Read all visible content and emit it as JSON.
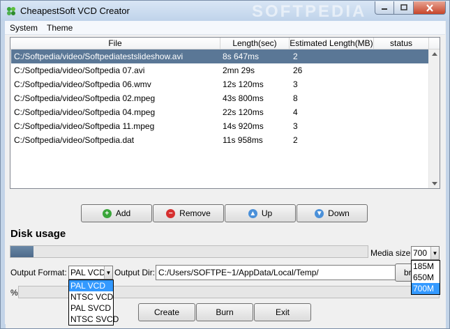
{
  "window": {
    "title": "CheapestSoft VCD Creator",
    "watermark": "SOFTPEDIA",
    "min_icon": "minimize-icon",
    "max_icon": "maximize-icon",
    "close_icon": "close-icon"
  },
  "menu": {
    "items": [
      "System",
      "Theme"
    ]
  },
  "file_list": {
    "columns": [
      "File",
      "Length(sec)",
      "Estimated Length(MB)",
      "status"
    ],
    "rows": [
      {
        "file": "C:/Softpedia/video/Softpediatestslideshow.avi",
        "length": "8s 647ms",
        "size": "2",
        "status": ""
      },
      {
        "file": "C:/Softpedia/video/Softpedia 07.avi",
        "length": "2mn 29s",
        "size": "26",
        "status": ""
      },
      {
        "file": "C:/Softpedia/video/Softpedia 06.wmv",
        "length": "12s 120ms",
        "size": "3",
        "status": ""
      },
      {
        "file": "C:/Softpedia/video/Softpedia 02.mpeg",
        "length": "43s 800ms",
        "size": "8",
        "status": ""
      },
      {
        "file": "C:/Softpedia/video/Softpedia 04.mpeg",
        "length": "22s 120ms",
        "size": "4",
        "status": ""
      },
      {
        "file": "C:/Softpedia/video/Softpedia 11.mpeg",
        "length": "14s 920ms",
        "size": "3",
        "status": ""
      },
      {
        "file": "C:/Softpedia/video/Softpedia.dat",
        "length": "11s 958ms",
        "size": "2",
        "status": ""
      }
    ],
    "selected_row": 0
  },
  "list_buttons": {
    "add": "Add",
    "remove": "Remove",
    "up": "Up",
    "down": "Down"
  },
  "disk": {
    "title": "Disk usage",
    "usage_fraction": 0.065,
    "media_size_label": "Media size:",
    "media_size_value": "700",
    "media_size_options": [
      "185M",
      "650M",
      "700M"
    ],
    "media_size_selected": "700M"
  },
  "output": {
    "format_label": "Output Format:",
    "format_value": "PAL VCD",
    "format_options": [
      "PAL VCD",
      "NTSC VCD",
      "PAL SVCD",
      "NTSC SVCD"
    ],
    "format_selected": "PAL VCD",
    "dir_label": "Output Dir:",
    "dir_value": "C:/Users/SOFTPE~1/AppData/Local/Temp/",
    "browse_label": "br"
  },
  "progress": {
    "label": "%",
    "fraction": 0
  },
  "actions": {
    "create": "Create",
    "burn": "Burn",
    "exit": "Exit"
  },
  "colors": {
    "selection": "#5a7796",
    "dropdown_highlight": "#3399ff",
    "progress_fill": "#55728f",
    "add_icon": "#3aa63a",
    "remove_icon": "#d63030",
    "arrow_icon": "#4a90d9"
  }
}
